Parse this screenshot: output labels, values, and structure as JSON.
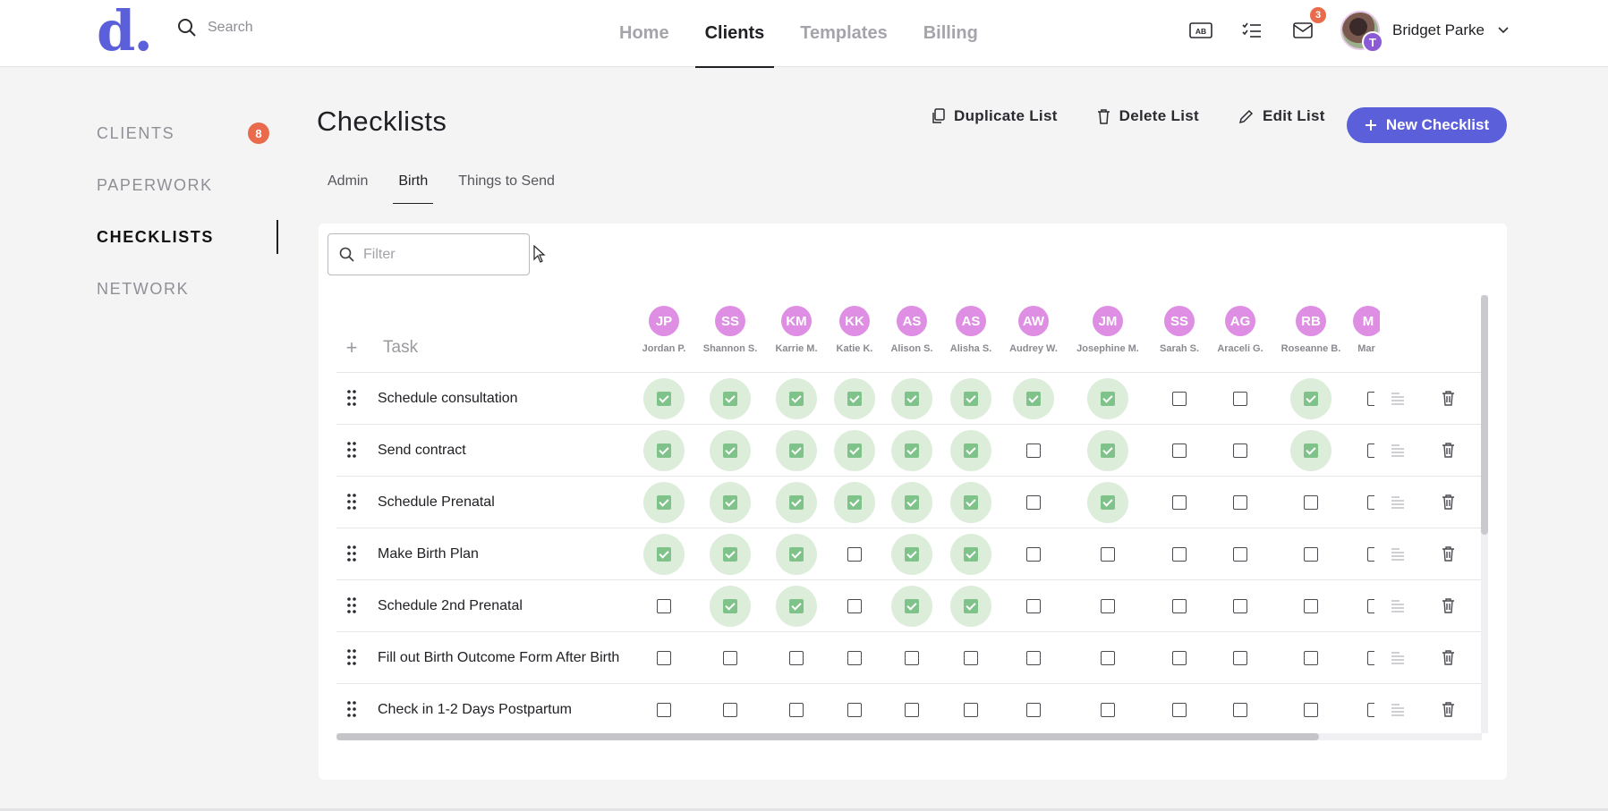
{
  "logo": "d.",
  "search": {
    "placeholder": "Search"
  },
  "nav": [
    "Home",
    "Clients",
    "Templates",
    "Billing"
  ],
  "nav_active": "Clients",
  "top_icons": [
    "ab-icon",
    "checklist-icon",
    "mail-icon"
  ],
  "mail_badge": "3",
  "user": {
    "name": "Bridget Parke",
    "badge_initial": "T"
  },
  "sidebar": {
    "items": [
      {
        "label": "CLIENTS",
        "badge": "8"
      },
      {
        "label": "PAPERWORK"
      },
      {
        "label": "CHECKLISTS"
      },
      {
        "label": "NETWORK"
      }
    ],
    "active": "CHECKLISTS"
  },
  "page_title": "Checklists",
  "actions": {
    "duplicate": "Duplicate List",
    "delete": "Delete List",
    "edit": "Edit List",
    "new": "New Checklist"
  },
  "tabs": [
    "Admin",
    "Birth",
    "Things to Send"
  ],
  "tab_active": "Birth",
  "filter": {
    "placeholder": "Filter"
  },
  "task_header": "Task",
  "clients": [
    {
      "initials": "JP",
      "name": "Jordan P."
    },
    {
      "initials": "SS",
      "name": "Shannon S."
    },
    {
      "initials": "KM",
      "name": "Karrie M."
    },
    {
      "initials": "KK",
      "name": "Katie K."
    },
    {
      "initials": "AS",
      "name": "Alison S."
    },
    {
      "initials": "AS",
      "name": "Alisha S."
    },
    {
      "initials": "AW",
      "name": "Audrey W."
    },
    {
      "initials": "JM",
      "name": "Josephine M."
    },
    {
      "initials": "SS",
      "name": "Sarah S."
    },
    {
      "initials": "AG",
      "name": "Araceli G."
    },
    {
      "initials": "RB",
      "name": "Roseanne B."
    },
    {
      "initials": "M",
      "name": "Mar"
    }
  ],
  "tasks": [
    {
      "name": "Schedule consultation",
      "checks": [
        1,
        1,
        1,
        1,
        1,
        1,
        1,
        1,
        0,
        0,
        1
      ]
    },
    {
      "name": "Send contract",
      "checks": [
        1,
        1,
        1,
        1,
        1,
        1,
        0,
        1,
        0,
        0,
        1
      ]
    },
    {
      "name": "Schedule Prenatal",
      "checks": [
        1,
        1,
        1,
        1,
        1,
        1,
        0,
        1,
        0,
        0,
        0
      ]
    },
    {
      "name": "Make Birth Plan",
      "checks": [
        1,
        1,
        1,
        0,
        1,
        1,
        0,
        0,
        0,
        0,
        0
      ]
    },
    {
      "name": "Schedule 2nd Prenatal",
      "checks": [
        0,
        1,
        1,
        0,
        1,
        1,
        0,
        0,
        0,
        0,
        0
      ]
    },
    {
      "name": "Fill out Birth Outcome Form After Birth",
      "checks": [
        0,
        0,
        0,
        0,
        0,
        0,
        0,
        0,
        0,
        0,
        0
      ]
    },
    {
      "name": "Check in 1-2 Days Postpartum",
      "checks": [
        0,
        0,
        0,
        0,
        0,
        0,
        0,
        0,
        0,
        0,
        0
      ]
    }
  ]
}
